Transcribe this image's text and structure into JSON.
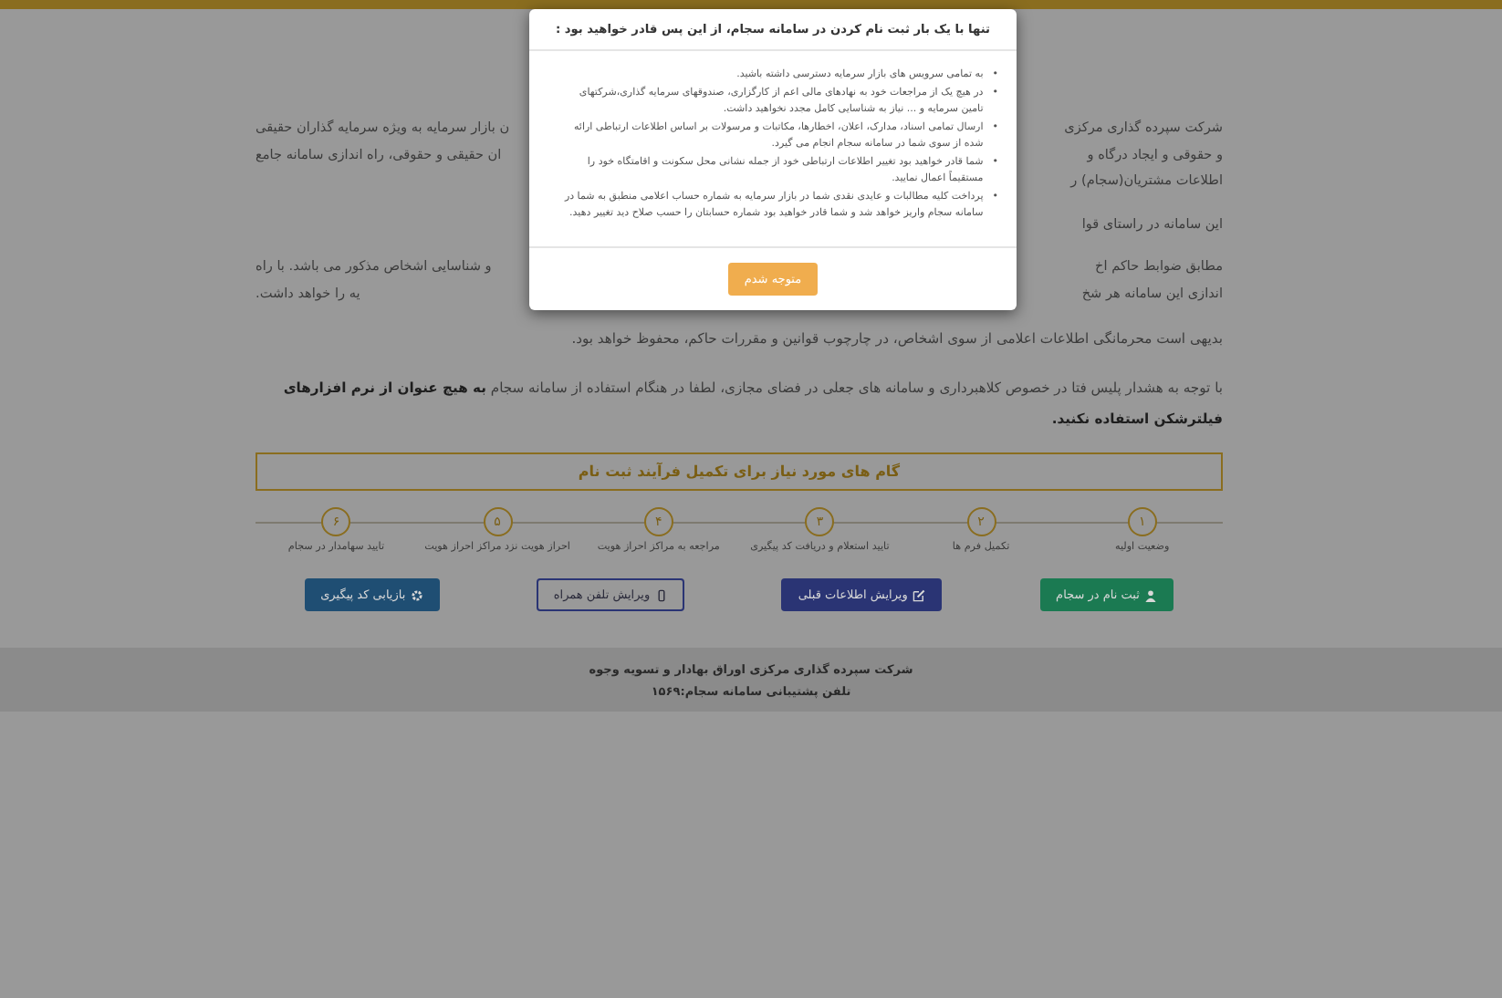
{
  "intro_lines": [
    {
      "right": "شرکت سپرده گذاری مرکزی",
      "left": "ن بازار سرمایه به ویژه سرمایه گذاران حقیقی"
    },
    {
      "right": "و حقوقی و ایجاد درگاه و",
      "left": "ان حقیقی و حقوقی، راه اندازی سامانه جامع"
    },
    {
      "right": "اطلاعات مشتریان(سجام) ر"
    }
  ],
  "para2_lines": [
    {
      "right": "این سامانه در راستای قوا"
    }
  ],
  "para3_lines": [
    {
      "right": "مطابق ضوابط حاکم اخ",
      "left": "و شناسایی اشخاص مذکور می باشد. با راه"
    },
    {
      "right": "اندازی این سامانه هر شخ",
      "left": "یه را خواهد داشت."
    }
  ],
  "privacy_text": "بدیهی است محرمانگی اطلاعات اعلامی از سوی اشخاص، در چارچوب قوانین و مقررات حاکم، محفوظ خواهد بود.",
  "warning_text": "با توجه به هشدار پلیس فتا در خصوص کلاهبرداری و سامانه های جعلی در فضای مجازی، لطفا در هنگام استفاده از سامانه سجام **به هیچ عنوان از نرم افزارهای فیلترشکن استفاده نکنید.**",
  "steps_heading": "گام های مورد نیاز برای تکمیل فرآیند ثبت نام",
  "steps": [
    {
      "number": "۱",
      "label": "وضعیت اولیه"
    },
    {
      "number": "۲",
      "label": "تکمیل فرم ها"
    },
    {
      "number": "۳",
      "label": "تایید استعلام و دریافت کد پیگیری"
    },
    {
      "number": "۴",
      "label": "مراجعه به مراکز احراز هویت"
    },
    {
      "number": "۵",
      "label": "احراز هویت نزد مراکز احراز هویت"
    },
    {
      "number": "۶",
      "label": "تایید سهامدار در سجام"
    }
  ],
  "buttons": [
    {
      "label": "ثبت نام در سجام",
      "kind": "register"
    },
    {
      "label": "ویرایش اطلاعات قبلی",
      "kind": "edit"
    },
    {
      "label": "ویرایش تلفن همراه",
      "kind": "phone"
    },
    {
      "label": "بازیابی کد پیگیری",
      "kind": "recover"
    }
  ],
  "footer": {
    "company": "شرکت سپرده گذاری مرکزی اوراق بهادار و تسویه وجوه",
    "phone": "تلفن پشتیبانی سامانه سجام:۱۵۶۹"
  },
  "modal": {
    "title": "تنها با یک بار ثبت نام کردن در سامانه سجام، از این پس قادر خواهید بود :",
    "items": [
      {
        "bullet": "•",
        "text": "به تمامی سرویس های بازار سرمایه دسترسی داشته باشید."
      },
      {
        "bullet": "•",
        "text": "در هیچ یک از مراجعات خود به نهادهای مالی اعم از کارگزاری، صندوقهای سرمایه گذاری،شرکتهای تامین سرمایه و ... نیاز به شناسایی کامل مجدد نخواهید داشت."
      },
      {
        "bullet": "•",
        "text": "ارسال تمامی اسناد، مدارک، اعلان، اخطارها، مکاتبات و مرسولات بر اساس اطلاعات ارتباطی ارائه شده از سوی شما در سامانه سجام انجام می گیرد."
      },
      {
        "bullet": "•",
        "text": "شما قادر خواهید بود تغییر اطلاعات ارتباطی خود از جمله نشانی محل سکونت و اقامتگاه خود را مستقیماً اعمال نمایید."
      },
      {
        "bullet": "•",
        "text": "پرداخت کلیه مطالبات و عایدی نقدی شما در بازار سرمایه به شماره حساب اعلامی منطبق به شما در سامانه سجام واریز خواهد شد و شما قادر خواهید بود شماره حسابتان را حسب صلاح دید تغییر دهید."
      }
    ],
    "button": "متوجه شدم"
  }
}
